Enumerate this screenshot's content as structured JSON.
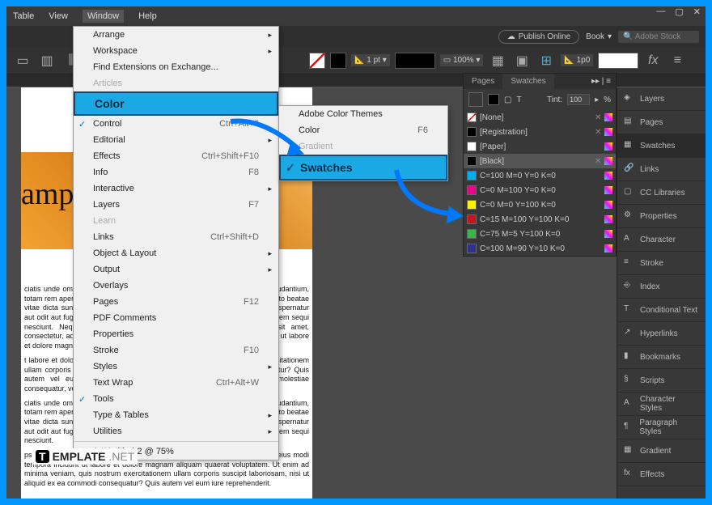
{
  "menubar": {
    "items": [
      "Table",
      "View",
      "Window",
      "Help"
    ],
    "active": "Window"
  },
  "topbar": {
    "publish": "Publish Online",
    "workspace": "Book",
    "search_placeholder": "Adobe Stock"
  },
  "toolbar": {
    "stroke_pt": "1 pt",
    "zoom": "100%",
    "inset": "1p0"
  },
  "window_menu": {
    "items": [
      {
        "label": "Arrange",
        "expandable": true
      },
      {
        "label": "Workspace",
        "expandable": true
      },
      {
        "label": "Find Extensions on Exchange..."
      },
      {
        "label": "Articles",
        "disabled": true
      },
      {
        "label": "Color",
        "highlighted": true,
        "expandable": true
      },
      {
        "label": "Control",
        "checked": true,
        "shortcut": "Ctrl+Alt+6"
      },
      {
        "label": "Editorial",
        "expandable": true
      },
      {
        "label": "Effects",
        "shortcut": "Ctrl+Shift+F10"
      },
      {
        "label": "Info",
        "shortcut": "F8"
      },
      {
        "label": "Interactive",
        "expandable": true
      },
      {
        "label": "Layers",
        "shortcut": "F7"
      },
      {
        "label": "Learn",
        "disabled": true
      },
      {
        "label": "Links",
        "shortcut": "Ctrl+Shift+D"
      },
      {
        "label": "Object & Layout",
        "expandable": true
      },
      {
        "label": "Output",
        "expandable": true
      },
      {
        "label": "Overlays"
      },
      {
        "label": "Pages",
        "shortcut": "F12"
      },
      {
        "label": "PDF Comments"
      },
      {
        "label": "Properties"
      },
      {
        "label": "Stroke",
        "shortcut": "F10"
      },
      {
        "label": "Styles",
        "expandable": true
      },
      {
        "label": "Text Wrap",
        "shortcut": "Ctrl+Alt+W"
      },
      {
        "label": "Tools",
        "checked": true
      },
      {
        "label": "Type & Tables",
        "expandable": true
      },
      {
        "label": "Utilities",
        "expandable": true
      },
      {
        "label": "1 *Untitled-2 @ 75%",
        "checked": true,
        "separator_before": true
      }
    ]
  },
  "color_submenu": {
    "items": [
      {
        "label": "Adobe Color Themes"
      },
      {
        "label": "Color",
        "shortcut": "F6"
      },
      {
        "label": "Gradient",
        "disabled": true
      },
      {
        "label": "Swatches",
        "highlighted": true,
        "checked": true
      }
    ]
  },
  "swatches_panel": {
    "tabs": [
      "Pages",
      "Swatches"
    ],
    "active_tab": "Swatches",
    "tint_label": "Tint:",
    "tint_value": "100",
    "tint_unit": "%",
    "rows": [
      {
        "name": "[None]",
        "color": "diag",
        "lock": true
      },
      {
        "name": "[Registration]",
        "color": "#000",
        "lock": true
      },
      {
        "name": "[Paper]",
        "color": "#fff"
      },
      {
        "name": "[Black]",
        "color": "#000",
        "lock": true,
        "selected": true
      },
      {
        "name": "C=100 M=0 Y=0 K=0",
        "color": "#00aeef"
      },
      {
        "name": "C=0 M=100 Y=0 K=0",
        "color": "#ec008c"
      },
      {
        "name": "C=0 M=0 Y=100 K=0",
        "color": "#fff200"
      },
      {
        "name": "C=15 M=100 Y=100 K=0",
        "color": "#c4161c"
      },
      {
        "name": "C=75 M=5 Y=100 K=0",
        "color": "#3bb54a"
      },
      {
        "name": "C=100 M=90 Y=10 K=0",
        "color": "#2e3192"
      }
    ]
  },
  "doc": {
    "bigtext": "ampl",
    "lorem1": "ciatis unde omnis iste natus error sit voluptatem accusantium doloremque laudantium, totam rem aperiam, eaque ipsa quae ab illo inventore veritatis et quasi architecto beatae vitae dicta sunt explicabo. Nemo enim ipsam voluptatem quia voluptas sit aspernatur aut odit aut fugit, sed quia consequatur magni dolores eos qui ratione voluptatem sequi nesciunt. Neque porro quisquam est, qui dolorem ipsum quia dolor sit amet, consectetur, adipisci velit, sed quia non numquam eius modi tempora incidunt ut labore et dolore magnam aliquam quaerat voluptatem.",
    "lorem2": "t labore et dolore magna aliqua. Ut enim ad minim veniam, quis nostrud exercitationem ullam corporis suscipit laboriosam, nisi ut aliquid ex ea commodi consequatur? Quis autem vel eum iure reprehenderit qui in ea voluptatem quam nihil molestiae consequatur, vel illum qui dolorem eum fugiat quo voluptas nulla pariatur.",
    "lorem3": "ciatis unde omnis iste natus error sit voluptatem accusantium doloremque laudantium, totam rem aperiam, eaque ipsa quae ab illo inventore veritatis et quasi architecto beatae vitae dicta sunt explicabo. Nemo enim ipsam voluptatem quia voluptas sit aspernatur aut odit aut fugit, sed quia consequatur magni dolores eos qui ratione voluptatem sequi nesciunt.",
    "lorem4": "psum quia dolor sit amet, consectetur, adipisci velit, sed quia non numquam eius modi tempora incidunt ut labore et dolore magnam aliquam quaerat voluptatem. Ut enim ad minima veniam, quis nostrum exercitationem ullam corporis suscipit laboriosam, nisi ut aliquid ex ea commodi consequatur? Quis autem vel eum iure reprehenderit."
  },
  "right_panels": [
    {
      "label": "Layers",
      "icon": "layers"
    },
    {
      "label": "Pages",
      "icon": "pages"
    },
    {
      "label": "Swatches",
      "icon": "swatches",
      "active": true
    },
    {
      "label": "Links",
      "icon": "links"
    },
    {
      "label": "CC Libraries",
      "icon": "cc"
    },
    {
      "label": "Properties",
      "icon": "props"
    },
    {
      "label": "Character",
      "icon": "char"
    },
    {
      "label": "Stroke",
      "icon": "stroke"
    },
    {
      "label": "Index",
      "icon": "index"
    },
    {
      "label": "Conditional Text",
      "icon": "cond"
    },
    {
      "label": "Hyperlinks",
      "icon": "hyper"
    },
    {
      "label": "Bookmarks",
      "icon": "book"
    },
    {
      "label": "Scripts",
      "icon": "scripts"
    },
    {
      "label": "Character Styles",
      "icon": "cstyle"
    },
    {
      "label": "Paragraph Styles",
      "icon": "pstyle"
    },
    {
      "label": "Gradient",
      "icon": "grad"
    },
    {
      "label": "Effects",
      "icon": "fx"
    }
  ],
  "watermark": {
    "t": "T",
    "name": "EMPLATE",
    "net": ".NET"
  }
}
